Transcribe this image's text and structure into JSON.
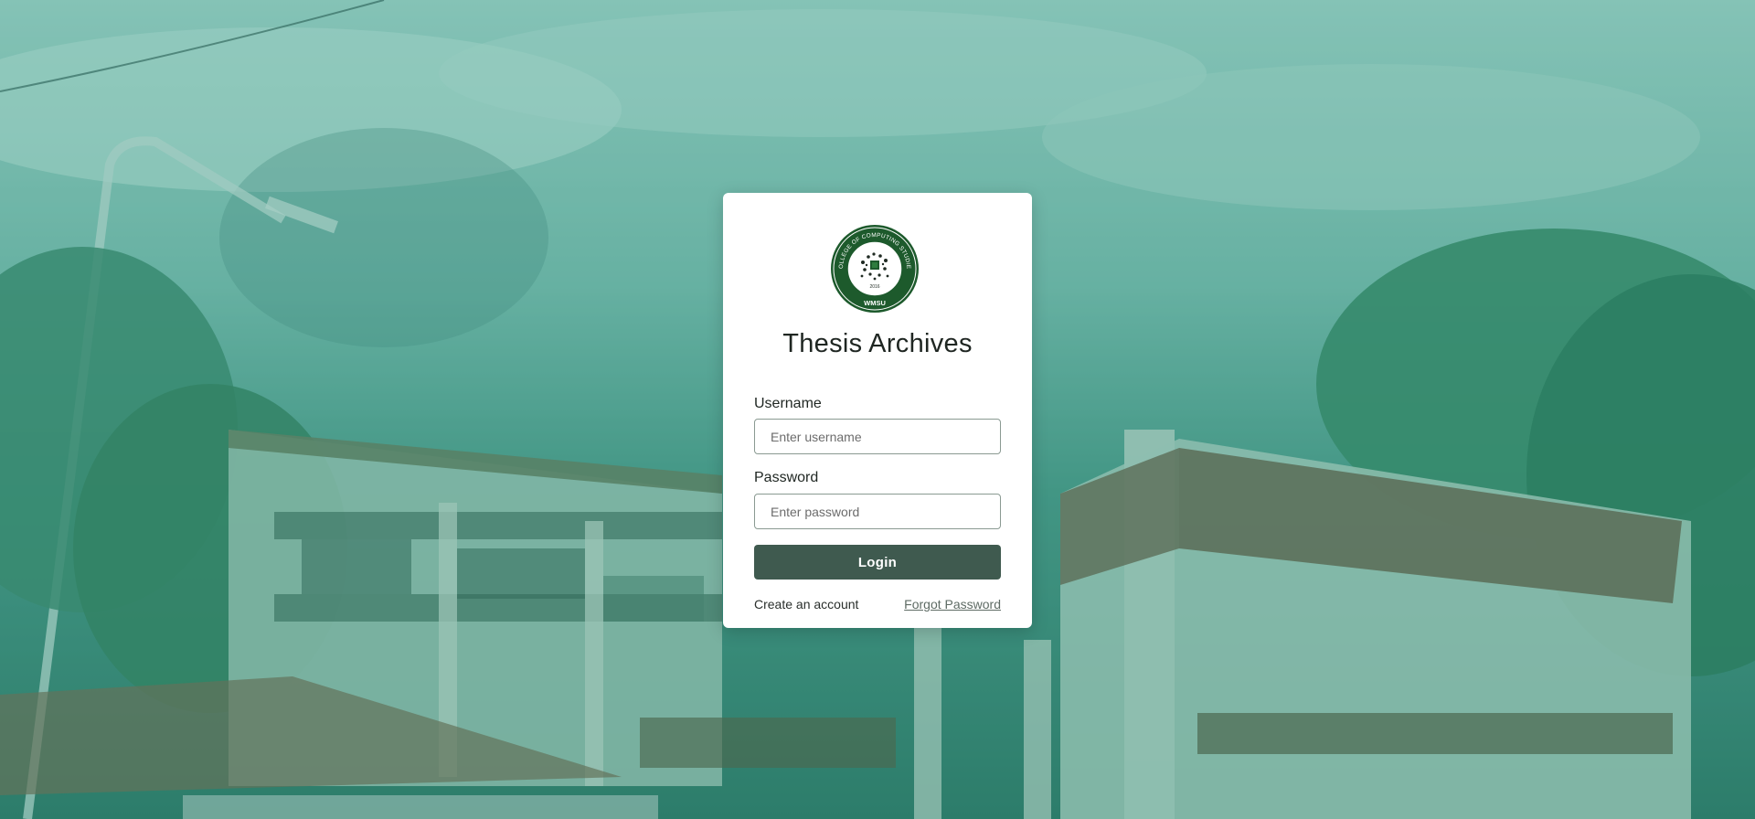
{
  "app": {
    "title": "Thesis Archives"
  },
  "logo": {
    "ring_text": "COLLEGE OF COMPUTING STUDIES",
    "bottom_text": "WMSU",
    "year": "2016"
  },
  "form": {
    "username": {
      "label": "Username",
      "placeholder": "Enter username",
      "value": ""
    },
    "password": {
      "label": "Password",
      "placeholder": "Enter password",
      "value": ""
    },
    "login_label": "Login"
  },
  "links": {
    "create_account": "Create an account",
    "forgot_password": "Forgot Password"
  },
  "colors": {
    "primary_button": "#3f5a4f",
    "logo_green": "#1d5a2c",
    "background_tint": "#4d9a8a"
  }
}
